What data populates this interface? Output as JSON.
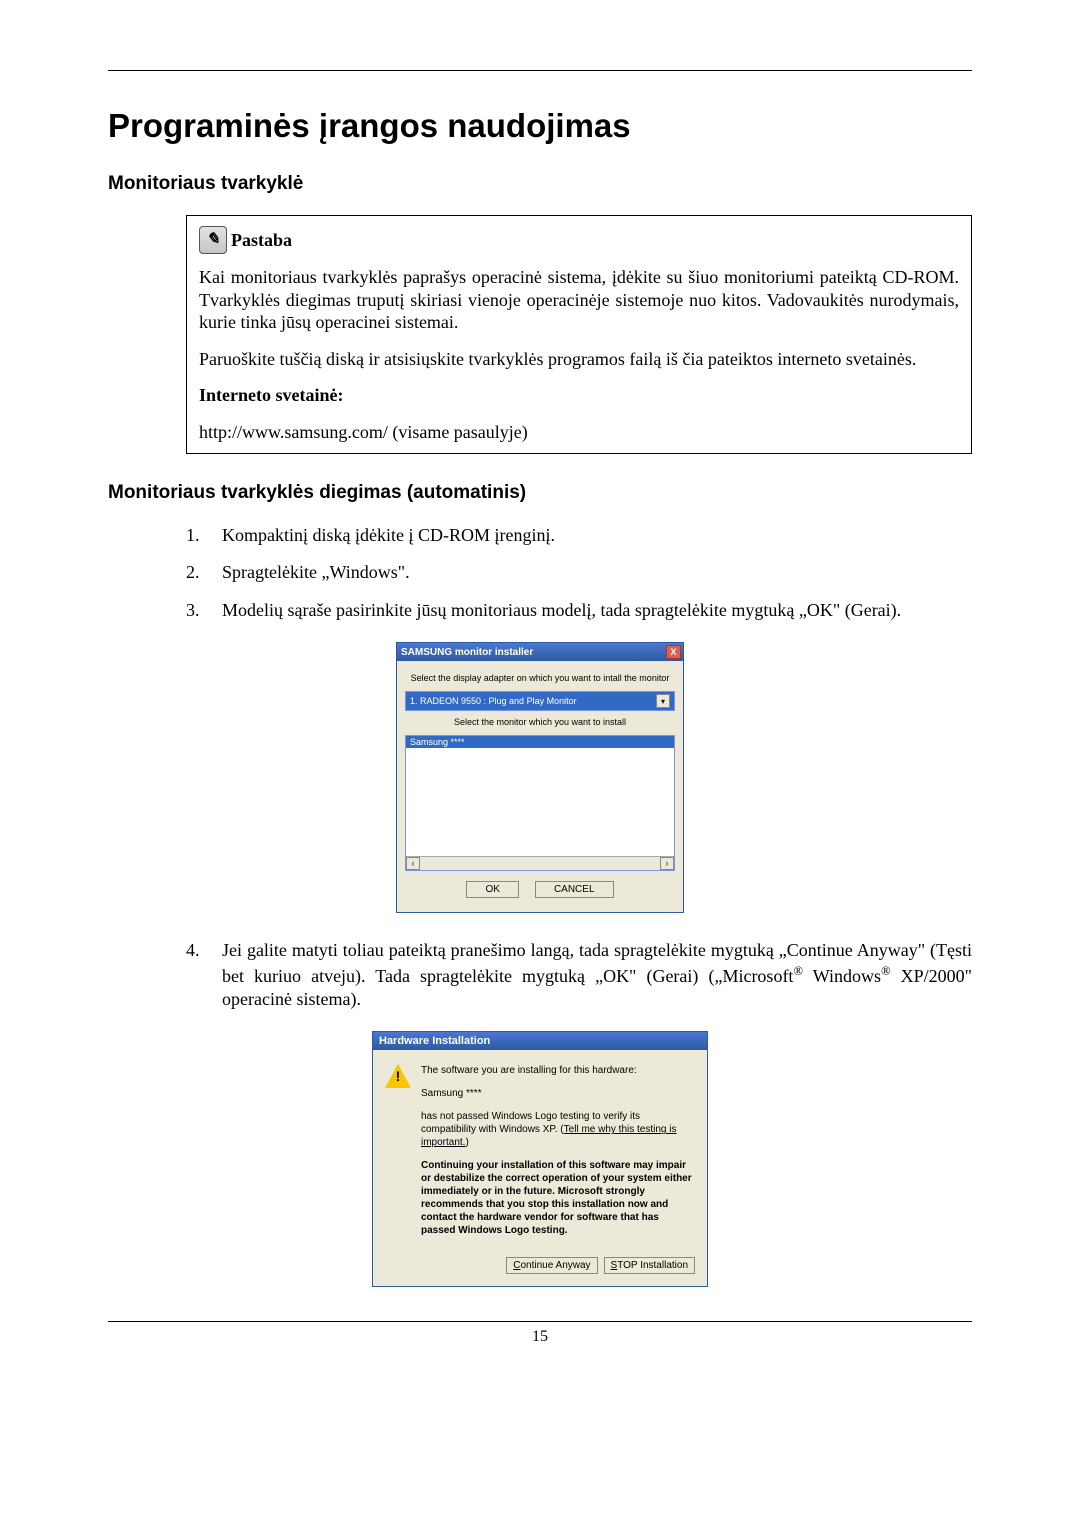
{
  "page": {
    "title": "Programinės įrangos naudojimas",
    "section1": "Monitoriaus tvarkyklė",
    "section2": "Monitoriaus tvarkyklės diegimas (automatinis)",
    "page_number": "15"
  },
  "note": {
    "icon_glyph": "✎",
    "title": "Pastaba",
    "p1": "Kai monitoriaus tvarkyklės paprašys operacinė sistema, įdėkite su šiuo monitoriumi pateiktą CD-ROM. Tvarkyklės diegimas truputį skiriasi vienoje operacinėje sistemoje nuo kitos. Vadovaukitės nurodymais, kurie tinka jūsų operacinei sistemai.",
    "p2": "Paruoškite tuščią diską ir atsisiųskite tvarkyklės programos failą iš čia pateiktos interneto svetainės.",
    "label_internet": "Interneto svetainė:",
    "url": "http://www.samsung.com/ (visame pasaulyje)"
  },
  "steps": {
    "s1": "Kompaktinį diską įdėkite į CD-ROM įrenginį.",
    "s2": "Spragtelėkite „Windows\".",
    "s3": "Modelių sąraše pasirinkite jūsų monitoriaus modelį, tada spragtelėkite mygtuką „OK\" (Gerai).",
    "s4_a": "Jei galite matyti toliau pateiktą pranešimo langą, tada spragtelėkite mygtuką „Continue Anyway\" (Tęsti bet kuriuo atveju). Tada spragtelėkite mygtuką „OK\" (Gerai) („Microsoft",
    "s4_b": " Windows",
    "s4_c": " XP/2000\" operacinė sistema).",
    "reg": "®"
  },
  "installer": {
    "title": "SAMSUNG monitor installer",
    "close": "X",
    "label1": "Select the display adapter on which you want to intall the monitor",
    "dropdown": "1. RADEON 9550 : Plug and Play Monitor",
    "arrow": "▾",
    "label2": "Select the monitor which you want to install",
    "selected": "Samsung ****",
    "scroll_left": "‹",
    "scroll_right": "›",
    "ok": "OK",
    "cancel": "CANCEL"
  },
  "hwdlg": {
    "title": "Hardware Installation",
    "bang": "!",
    "p1": "The software you are installing for this hardware:",
    "p2": "Samsung ****",
    "p3a": "has not passed Windows Logo testing to verify its compatibility with Windows XP. (",
    "p3_link": "Tell me why this testing is important.",
    "p3b": ")",
    "p4": "Continuing your installation of this software may impair or destabilize the correct operation of your system either immediately or in the future. Microsoft strongly recommends that you stop this installation now and contact the hardware vendor for software that has passed Windows Logo testing.",
    "btn_continue_u": "C",
    "btn_continue_rest": "ontinue Anyway",
    "btn_stop_u": "S",
    "btn_stop_rest": "TOP Installation"
  }
}
